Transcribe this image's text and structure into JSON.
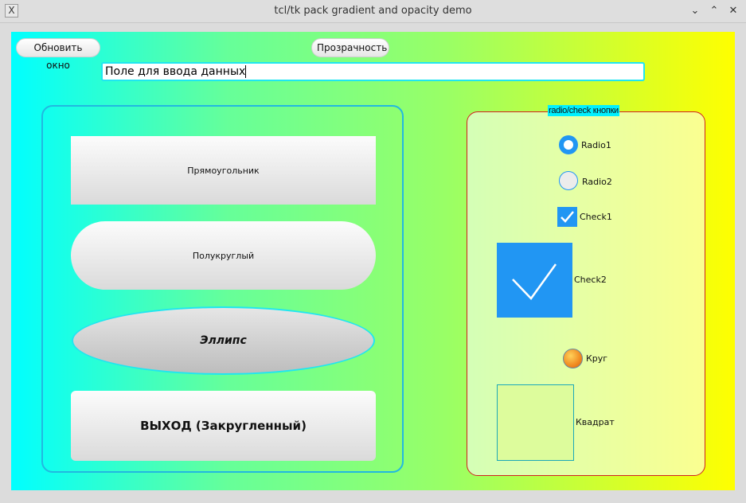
{
  "window": {
    "title": "tcl/tk pack gradient and opacity demo",
    "icon": "x11-icon",
    "controls": {
      "minimize": "⌄",
      "maximize": "⌃",
      "close": "✕"
    }
  },
  "toolbar": {
    "refresh_label": "Обновить окно",
    "opacity_label": "Прозрачность"
  },
  "entry": {
    "value": "Поле для ввода данных"
  },
  "buttons": {
    "rectangle": "Прямоугольник",
    "semicircle": "Полукруглый",
    "ellipse": "Эллипс",
    "exit": "ВЫХОД (Закругленный)"
  },
  "group": {
    "title": "radio/check кнопки",
    "radio1": {
      "label": "Radio1",
      "selected": true
    },
    "radio2": {
      "label": "Radio2",
      "selected": false
    },
    "check1": {
      "label": "Check1",
      "checked": true
    },
    "check2": {
      "label": "Check2",
      "checked": true
    },
    "circle": {
      "label": "Круг"
    },
    "square": {
      "label": "Квадрат"
    }
  },
  "colors": {
    "accent_blue": "#2196f3",
    "gradient_start": "#00ffff",
    "gradient_end": "#ffff00",
    "frame_border_left": "#22b8e0",
    "frame_border_right": "#d02020",
    "label_bg": "#00f0ff"
  }
}
